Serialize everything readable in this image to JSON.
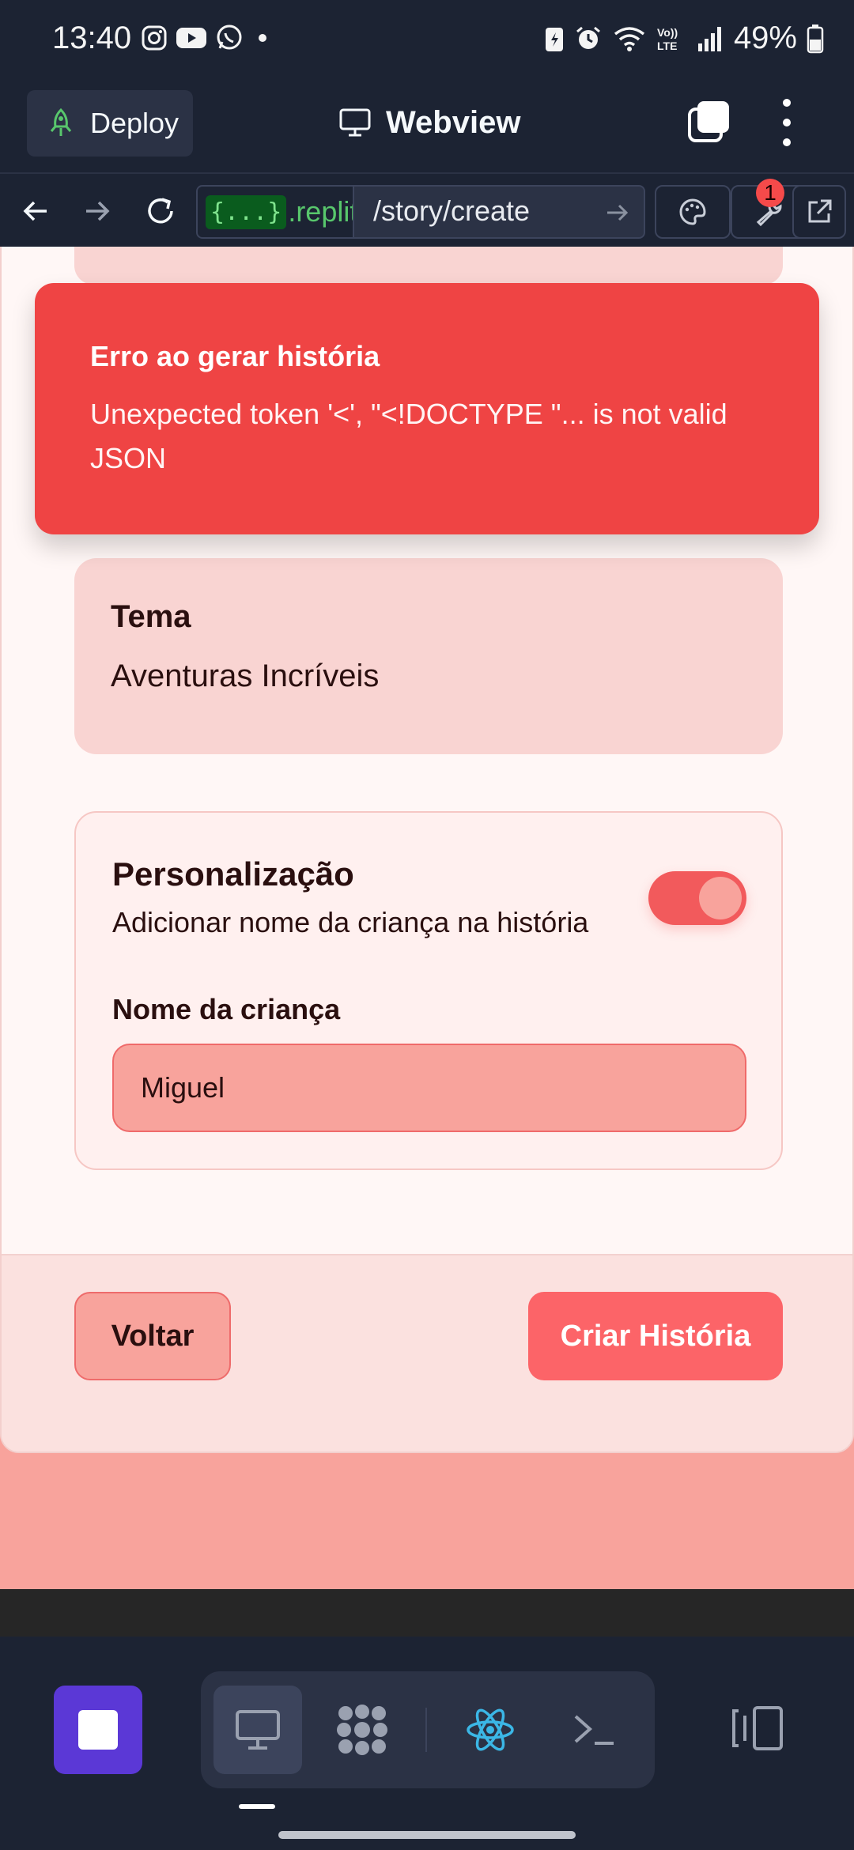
{
  "status_bar": {
    "time": "13:40",
    "battery": "49%",
    "left_icons": [
      "instagram-icon",
      "youtube-icon",
      "whatsapp-icon",
      "dot-icon"
    ],
    "right_icons": [
      "battery-saver-icon",
      "alarm-icon",
      "wifi-icon",
      "volte-icon",
      "signal-icon",
      "battery-icon"
    ]
  },
  "header": {
    "deploy_label": "Deploy",
    "title": "Webview"
  },
  "browser": {
    "host_badge": "{...}",
    "host_text": ".replit.c",
    "path": "/story/create",
    "notification_count": "1"
  },
  "page": {
    "error_title": "Erro ao gerar história",
    "error_message": "Unexpected token '<', \"<!DOCTYPE \"... is not valid JSON",
    "theme_label": "Tema",
    "theme_value": "Aventuras Incríveis",
    "personalization_title": "Personalização",
    "personalization_subtitle": "Adicionar nome da criança na história",
    "personalization_enabled": true,
    "child_name_label": "Nome da criança",
    "child_name_value": "Miguel",
    "back_button": "Voltar",
    "create_button": "Criar História"
  },
  "colors": {
    "app_bg": "#1c2333",
    "page_bg": "#f8a39c",
    "error": "#ef4444",
    "accent": "#fc6468",
    "stop_button": "#5b38d6"
  }
}
